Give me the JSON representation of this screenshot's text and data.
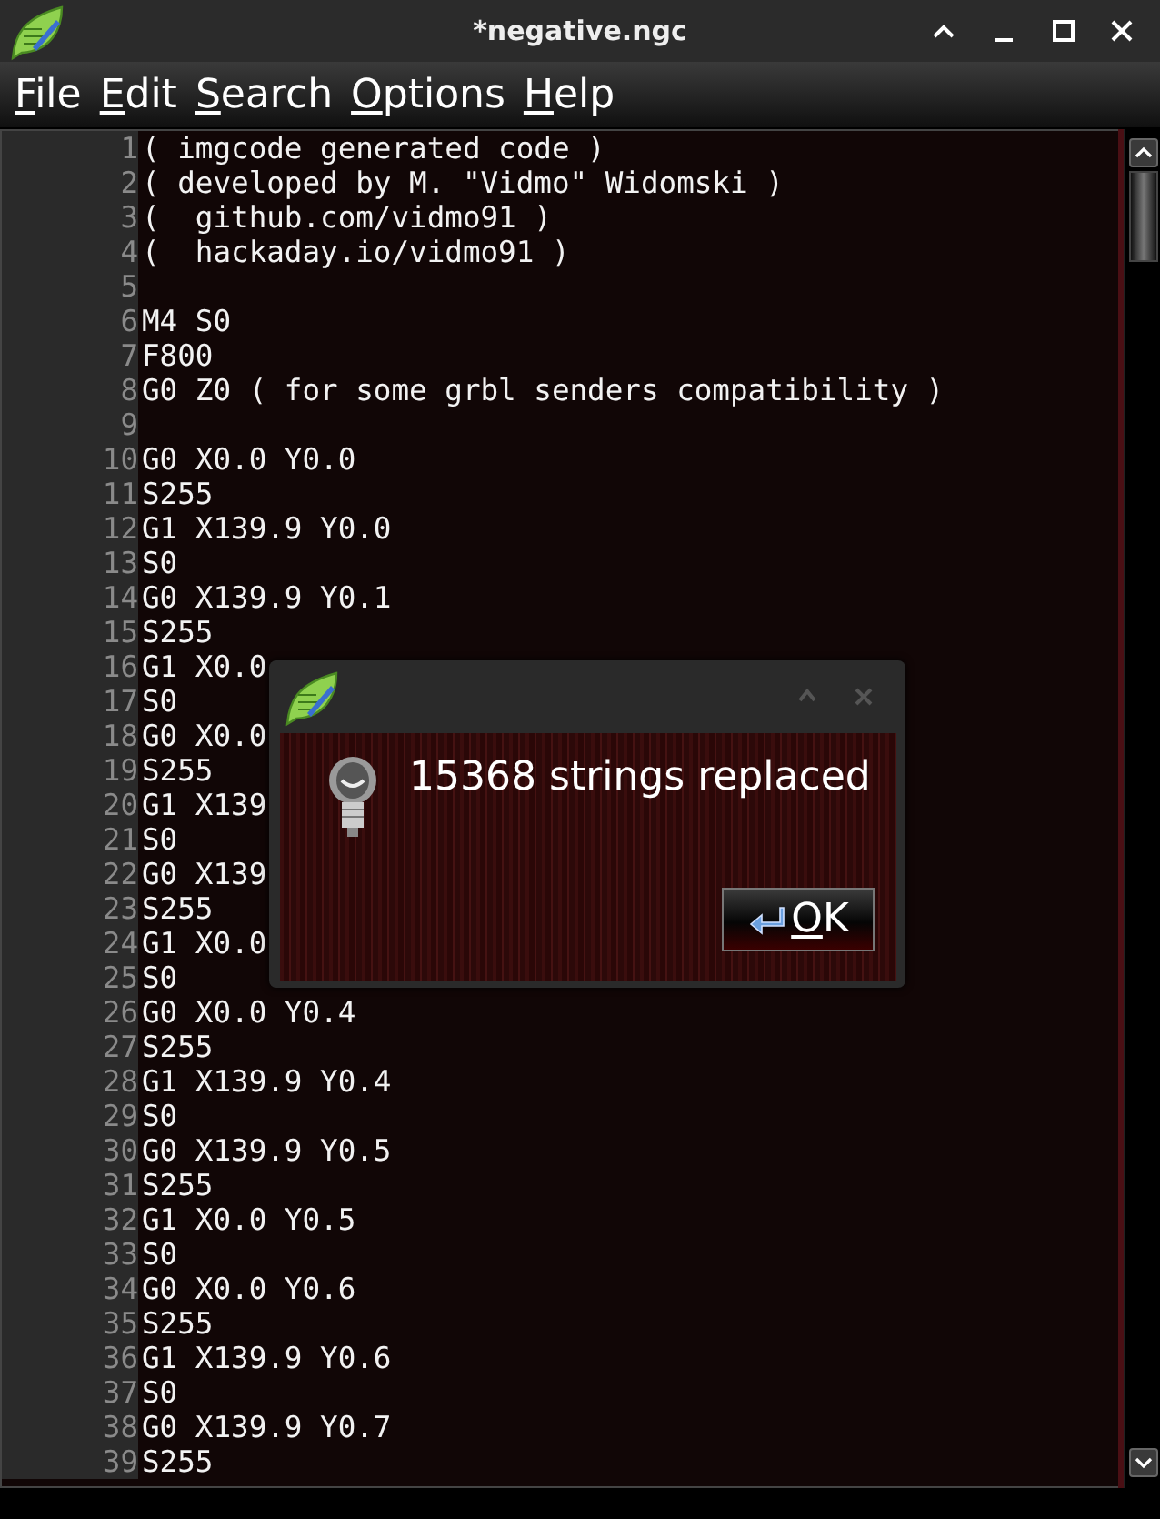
{
  "window": {
    "title": "*negative.ngc"
  },
  "menu": [
    "File",
    "Edit",
    "Search",
    "Options",
    "Help"
  ],
  "editor": {
    "lines": [
      {
        "number": "1",
        "text": "( imgcode generated code )"
      },
      {
        "number": "2",
        "text": "( developed by M. \"Vidmo\" Widomski )"
      },
      {
        "number": "3",
        "text": "(  github.com/vidmo91 )"
      },
      {
        "number": "4",
        "text": "(  hackaday.io/vidmo91 )"
      },
      {
        "number": "5"
      },
      {
        "number": "6",
        "text": "M4 S0"
      },
      {
        "number": "7",
        "text": "F800"
      },
      {
        "number": "8",
        "text": "G0 Z0 ( for some grbl senders compatibility )"
      },
      {
        "number": "9"
      },
      {
        "number": "10",
        "text": "G0 X0.0 Y0.0"
      },
      {
        "number": "11",
        "text": "S255"
      },
      {
        "number": "12",
        "text": "G1 X139.9 Y0.0"
      },
      {
        "number": "13",
        "text": "S0"
      },
      {
        "number": "14",
        "text": "G0 X139.9 Y0.1"
      },
      {
        "number": "15",
        "text": "S255"
      },
      {
        "number": "16",
        "text": "G1 X0.0"
      },
      {
        "number": "17",
        "text": "S0"
      },
      {
        "number": "18",
        "text": "G0 X0.0"
      },
      {
        "number": "19",
        "text": "S255"
      },
      {
        "number": "20",
        "text": "G1 X139"
      },
      {
        "number": "21",
        "text": "S0"
      },
      {
        "number": "22",
        "text": "G0 X139"
      },
      {
        "number": "23",
        "text": "S255"
      },
      {
        "number": "24",
        "text": "G1 X0.0"
      },
      {
        "number": "25",
        "text": "S0"
      },
      {
        "number": "26",
        "text": "G0 X0.0 Y0.4"
      },
      {
        "number": "27",
        "text": "S255"
      },
      {
        "number": "28",
        "text": "G1 X139.9 Y0.4"
      },
      {
        "number": "29",
        "text": "S0"
      },
      {
        "number": "30",
        "text": "G0 X139.9 Y0.5"
      },
      {
        "number": "31",
        "text": "S255"
      },
      {
        "number": "32",
        "text": "G1 X0.0 Y0.5"
      },
      {
        "number": "33",
        "text": "S0"
      },
      {
        "number": "34",
        "text": "G0 X0.0 Y0.6"
      },
      {
        "number": "35",
        "text": "S255"
      },
      {
        "number": "36",
        "text": "G1 X139.9 Y0.6"
      },
      {
        "number": "37",
        "text": "S0"
      },
      {
        "number": "38",
        "text": "G0 X139.9 Y0.7"
      },
      {
        "number": "39",
        "text": "S255"
      }
    ]
  },
  "dialog": {
    "message": "15368 strings replaced",
    "button": "OK"
  }
}
